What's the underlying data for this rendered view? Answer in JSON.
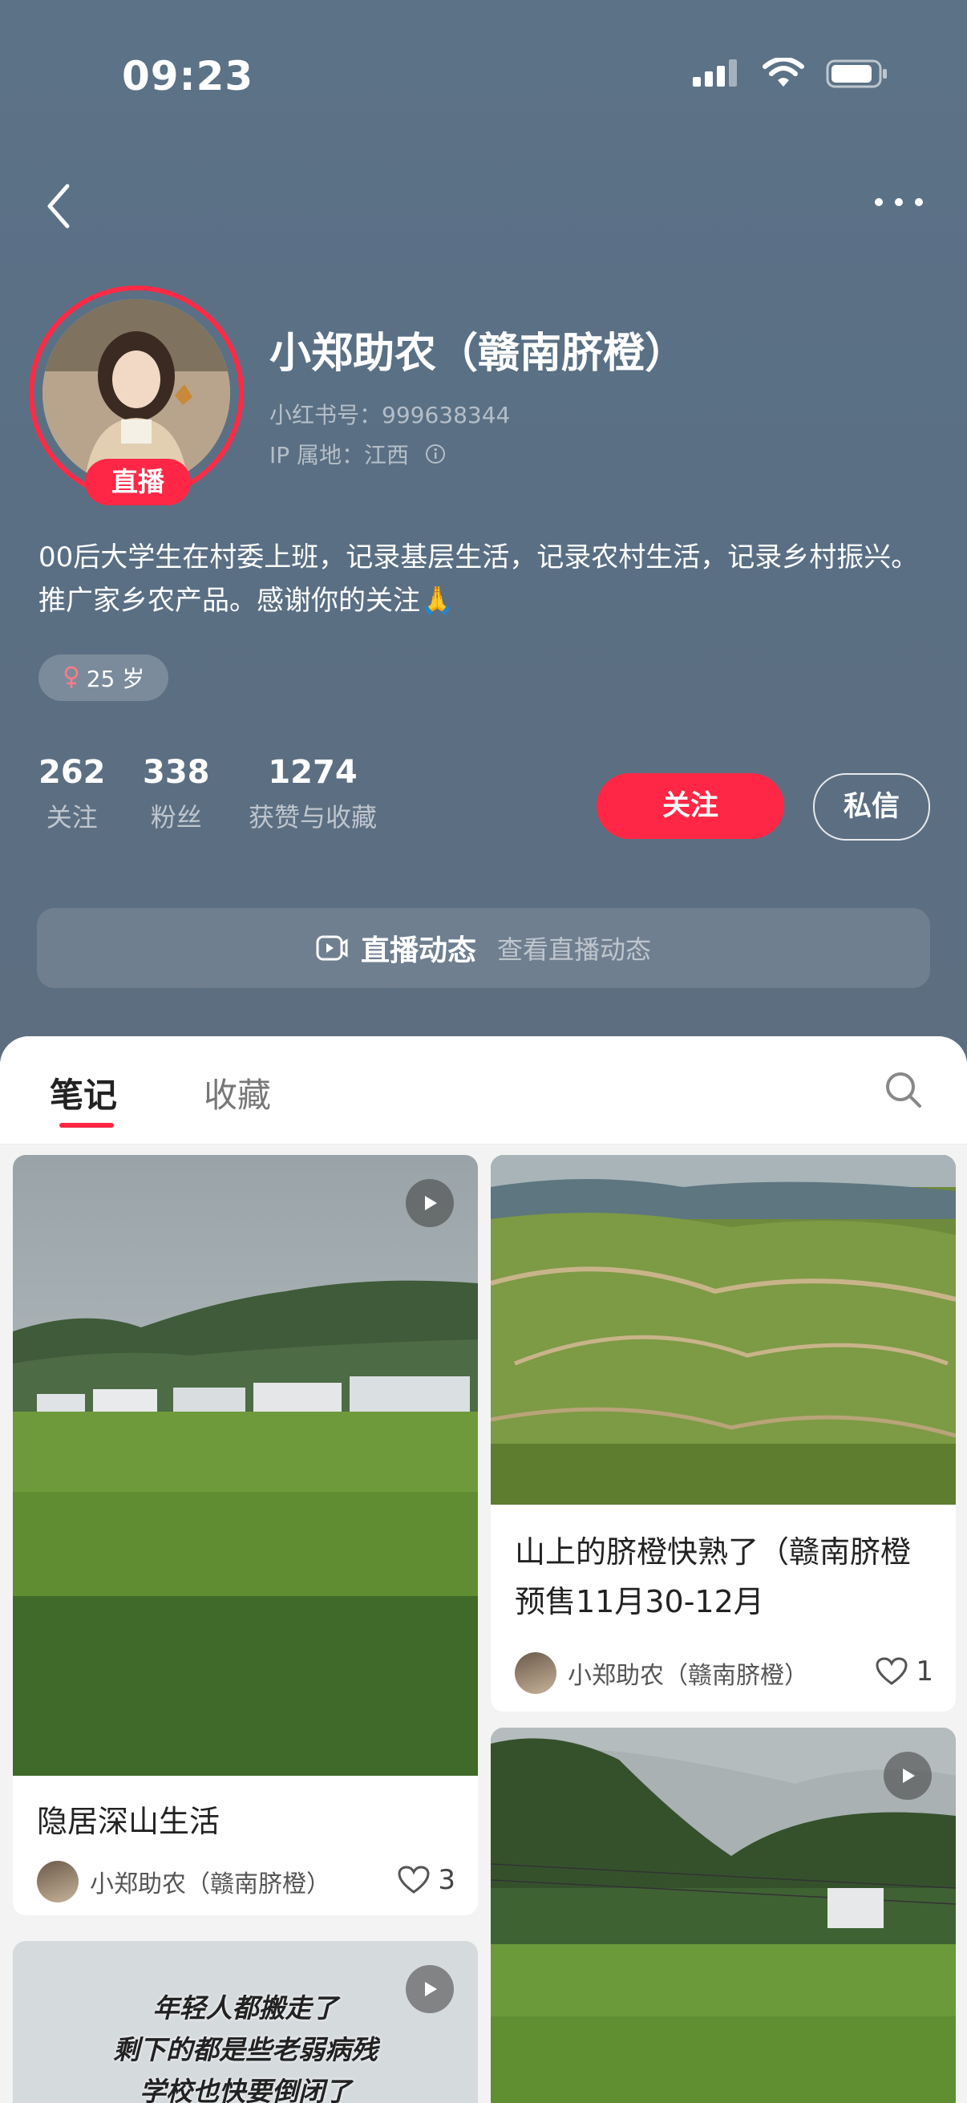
{
  "status_bar": {
    "time": "09:23"
  },
  "profile": {
    "name": "小郑助农（赣南脐橙）",
    "red_id": "小红书号：999638344",
    "ip_location": "IP 属地：江西",
    "live_badge": "直播",
    "bio": "00后大学生在村委上班，记录基层生活，记录农村生活，记录乡村振兴。推广家乡农产品。感谢你的关注🙏",
    "age_tag": "25 岁",
    "gender_icon": "female-icon",
    "stats": [
      {
        "value": "262",
        "label": "关注"
      },
      {
        "value": "338",
        "label": "粉丝"
      },
      {
        "value": "1274",
        "label": "获赞与收藏"
      }
    ],
    "follow_label": "关注",
    "message_label": "私信",
    "live_dynamic_label": "直播动态",
    "live_dynamic_link": "查看直播动态"
  },
  "tabs": [
    {
      "label": "笔记",
      "active": true
    },
    {
      "label": "收藏",
      "active": false
    }
  ],
  "notes": [
    {
      "title": "隐居深山生活",
      "author": "小郑助农（赣南脐橙）",
      "likes": "3",
      "is_video": true
    },
    {
      "title": "山上的脐橙快熟了（赣南脐橙预售11月30-12月",
      "author": "小郑助农（赣南脐橙）",
      "likes": "1",
      "is_video": false
    },
    {
      "overlay_text": [
        "年轻人都搬走了",
        "剩下的都是些老弱病残",
        "学校也快要倒闭了"
      ],
      "is_video": true
    },
    {
      "is_video": true
    }
  ],
  "colors": {
    "accent": "#ff2745",
    "header_bg": "#5c7287"
  }
}
